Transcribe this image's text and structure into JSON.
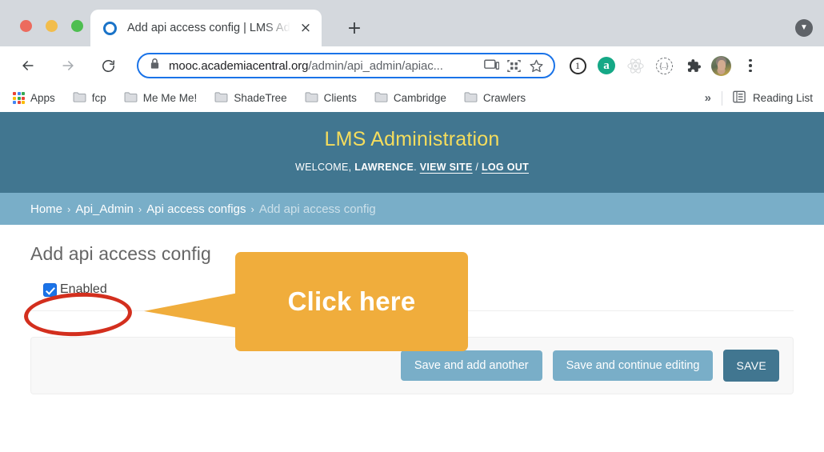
{
  "browser": {
    "window_controls": [
      "close",
      "minimize",
      "maximize"
    ],
    "tab": {
      "title": "Add api access config | LMS Ad",
      "favicon": "blue-circle-favicon",
      "close_label": "×"
    },
    "new_tab_label": "+",
    "nav": {
      "back": "←",
      "forward": "→",
      "reload": "⟳"
    },
    "omnibox": {
      "lock_icon": "lock-icon",
      "url_host": "mooc.academiacentral.org",
      "url_path": "/admin/api_admin/apiac...",
      "icons": [
        "cast-icon",
        "qr-code-icon",
        "bookmark-star-icon"
      ]
    },
    "extensions": [
      {
        "name": "one-password-extension",
        "glyph": "1"
      },
      {
        "name": "grammarly-extension",
        "glyph": "a"
      },
      {
        "name": "react-devtools-extension",
        "glyph": "react"
      },
      {
        "name": "dotted-circle-extension",
        "glyph": "{...}"
      },
      {
        "name": "extensions-puzzle-icon",
        "glyph": "puzzle"
      }
    ],
    "profile_avatar": "user-avatar",
    "menu_label": "kebab-menu",
    "bookmarks": [
      {
        "name": "apps",
        "label": "Apps",
        "icon": "apps-grid-icon"
      },
      {
        "name": "fcp",
        "label": "fcp",
        "icon": "folder-icon"
      },
      {
        "name": "me-me-me",
        "label": "Me Me Me!",
        "icon": "folder-icon"
      },
      {
        "name": "shadetree",
        "label": "ShadeTree",
        "icon": "folder-icon"
      },
      {
        "name": "clients",
        "label": "Clients",
        "icon": "folder-icon"
      },
      {
        "name": "cambridge",
        "label": "Cambridge",
        "icon": "folder-icon"
      },
      {
        "name": "crawlers",
        "label": "Crawlers",
        "icon": "folder-icon"
      }
    ],
    "bookmarks_overflow": "»",
    "reading_list": "Reading List"
  },
  "site": {
    "header": {
      "title": "LMS Administration",
      "welcome_prefix": "WELCOME,",
      "username": "LAWRENCE",
      "welcome_suffix": ".",
      "view_site": "VIEW SITE",
      "separator": "/",
      "log_out": "LOG OUT"
    },
    "breadcrumbs": [
      {
        "label": "Home",
        "current": false
      },
      {
        "label": "Api_Admin",
        "current": false
      },
      {
        "label": "Api access configs",
        "current": false
      },
      {
        "label": "Add api access config",
        "current": true
      }
    ],
    "breadcrumb_separator": "›",
    "page_title": "Add api access config",
    "form": {
      "enabled_label": "Enabled",
      "enabled_checked": true
    },
    "buttons": {
      "save_and_add_another": "Save and add another",
      "save_and_continue": "Save and continue editing",
      "save": "SAVE"
    }
  },
  "annotation": {
    "callout_text": "Click here",
    "callout_color": "#f0ad3c",
    "highlight_color": "#d32f1e",
    "target": "enabled-checkbox"
  },
  "colors": {
    "header_bg": "#417690",
    "breadcrumb_bg": "#79aec8",
    "header_title": "#f5dd5d",
    "button_secondary": "#79aec8",
    "button_primary": "#417690",
    "checkbox_blue": "#1a73e8"
  }
}
